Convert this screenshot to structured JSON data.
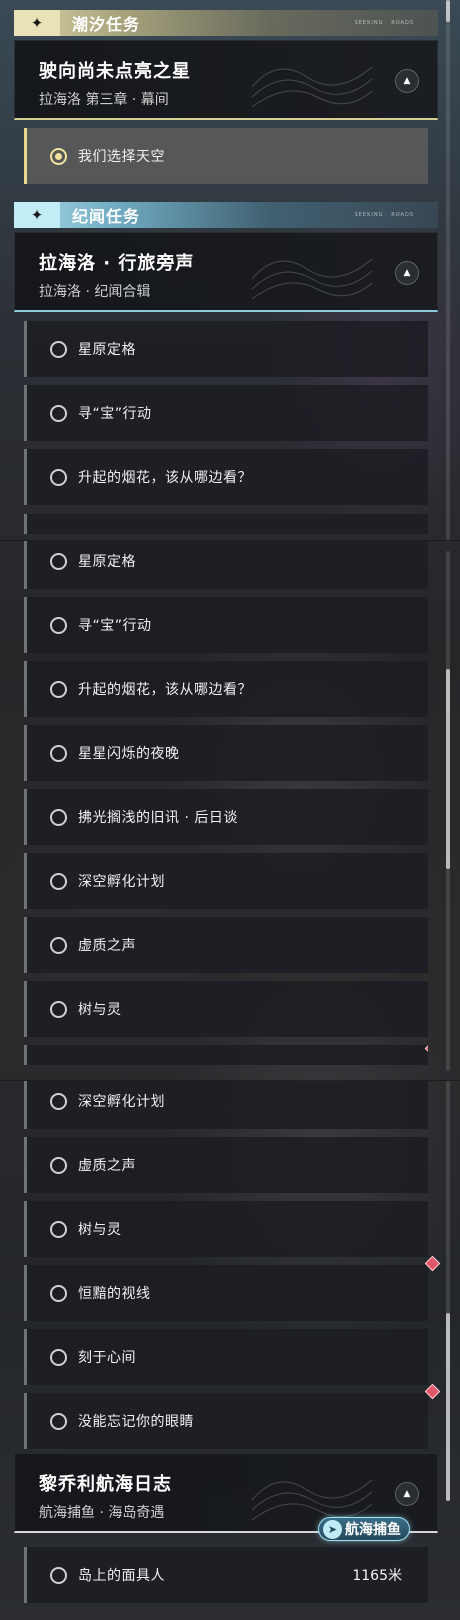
{
  "sections": {
    "tide_title": "潮汐任务",
    "lore_title": "纪闻任务",
    "tiny_text": "SEEKING · ROADS"
  },
  "groups": {
    "star": {
      "title": "驶向尚未点亮之星",
      "subtitle": "拉海洛 第三章 · 幕间"
    },
    "voices": {
      "title": "拉海洛 · 行旅旁声",
      "subtitle": "拉海洛 · 纪闻合辑"
    },
    "voyage": {
      "title": "黎乔利航海日志",
      "subtitle": "航海捕鱼 · 海岛奇遇"
    }
  },
  "tasks": {
    "choose_sky": "我们选择天空",
    "star_field": "星原定格",
    "treasure": "寻“宝”行动",
    "fireworks": "升起的烟花，该从哪边看？",
    "starry_night": "星星闪烁的夜晚",
    "old_news": "拂光搁浅的旧讯 · 后日谈",
    "deep_space": "深空孵化计划",
    "void_voice": "虚质之声",
    "tree_spirit": "树与灵",
    "gaze": "恒黯的视线",
    "engraved": "刻于心间",
    "eyes": "没能忘记你的眼睛",
    "island_mask": "岛上的面具人"
  },
  "badge": {
    "label": "航海捕鱼",
    "distance": "1165米"
  },
  "icons": {
    "star": "four-point-star-icon",
    "collapse": "chevron-up-icon",
    "radio": "radio-icon",
    "alert": "red-diamond-icon",
    "fish": "fish-icon"
  },
  "colors": {
    "tide_accent": "#d8cf95",
    "lore_accent": "#8fc9dc",
    "alert": "#e0566a"
  }
}
